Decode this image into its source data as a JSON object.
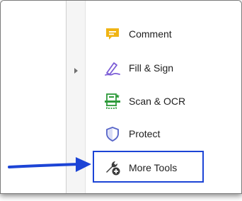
{
  "tools": [
    {
      "label": "Comment",
      "icon": "comment-icon",
      "color": "#f0b414"
    },
    {
      "label": "Fill & Sign",
      "icon": "fill-sign-pen-icon",
      "color": "#7b5cd6"
    },
    {
      "label": "Scan & OCR",
      "icon": "scan-ocr-icon",
      "color": "#2e9a3a"
    },
    {
      "label": "Protect",
      "icon": "shield-icon",
      "color": "#5866c9"
    },
    {
      "label": "More Tools",
      "icon": "wrench-plus-icon",
      "color": "#3c3c3c"
    }
  ],
  "highlight": {
    "target": "More Tools",
    "color": "#1c44d6"
  },
  "arrow": {
    "icon": "arrow-right-icon",
    "color": "#1c44d6"
  }
}
